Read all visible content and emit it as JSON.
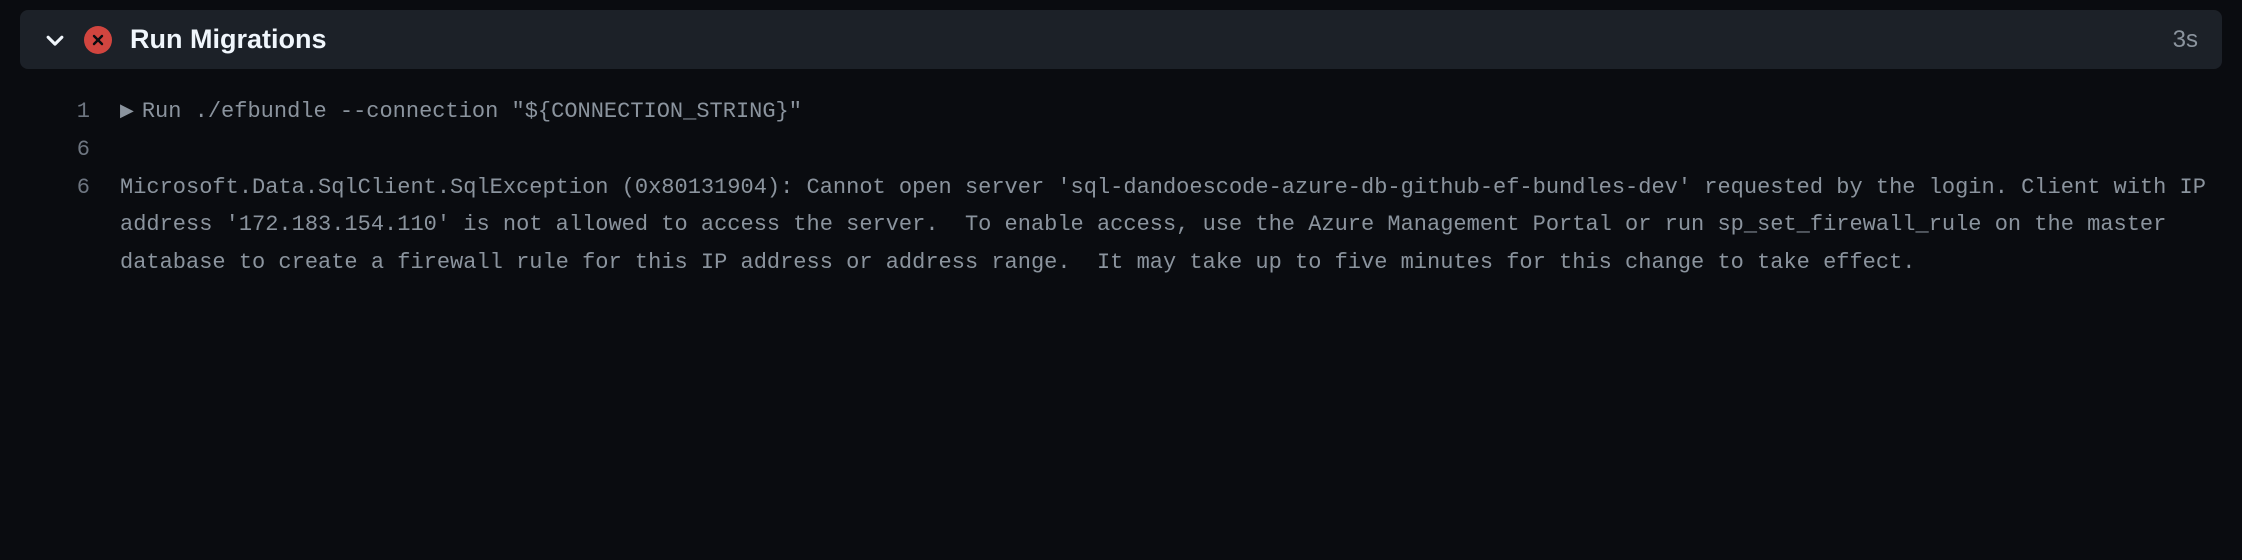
{
  "header": {
    "title": "Run Migrations",
    "duration": "3s",
    "status": "error"
  },
  "log": {
    "lines": [
      {
        "num": "1",
        "collapsed": true,
        "text": "Run ./efbundle --connection \"${CONNECTION_STRING}\""
      },
      {
        "num": "6",
        "text": ""
      },
      {
        "num": "6",
        "text": "Microsoft.Data.SqlClient.SqlException (0x80131904): Cannot open server 'sql-dandoescode-azure-db-github-ef-bundles-dev' requested by the login. Client with IP address '172.183.154.110' is not allowed to access the server.  To enable access, use the Azure Management Portal or run sp_set_firewall_rule on the master database to create a firewall rule for this IP address or address range.  It may take up to five minutes for this change to take effect."
      }
    ]
  }
}
